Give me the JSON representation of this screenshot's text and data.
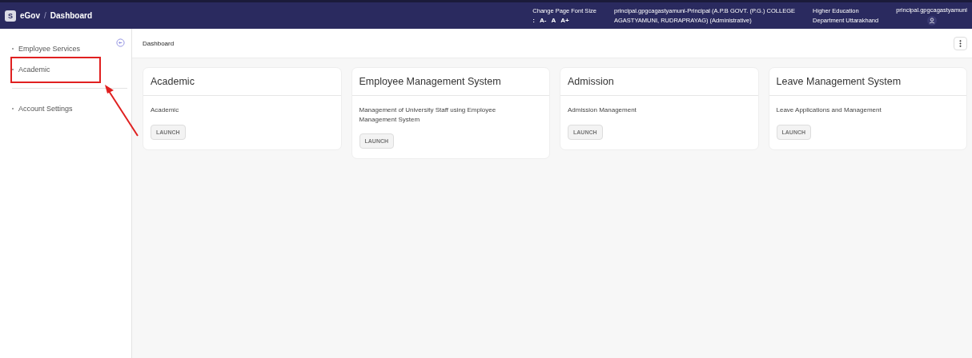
{
  "topbar": {
    "logo": "S",
    "app": "eGov",
    "separator": "/",
    "page": "Dashboard",
    "font_size": {
      "label": "Change Page Font Size",
      "colon": ":",
      "buttons": [
        "A-",
        "A",
        "A+"
      ]
    },
    "user_line1": "principal.gpgcagastyamuni-Principal (A.P.B GOVT. (P.G.) COLLEGE",
    "user_line2": "AGASTYAMUNI, RUDRAPRAYAG) (Administrative)",
    "department_line1": "Higher Education",
    "department_line2": "Department Uttarakhand",
    "username": "principal.gpgcagastyamuni"
  },
  "sidebar": {
    "groups": [
      {
        "items": [
          {
            "label": "Employee Services",
            "selected": false
          },
          {
            "label": "Academic",
            "selected": false,
            "highlighted": true
          }
        ]
      },
      {
        "items": [
          {
            "label": "Account Settings",
            "selected": false
          }
        ]
      }
    ]
  },
  "main": {
    "title": "Dashboard",
    "cards": [
      {
        "title": "Academic",
        "description": "Academic",
        "button": "LAUNCH"
      },
      {
        "title": "Employee Management System",
        "description": "Management of University Staff using Employee Management System",
        "button": "LAUNCH"
      },
      {
        "title": "Admission",
        "description": "Admission Management",
        "button": "LAUNCH"
      },
      {
        "title": "Leave Management System",
        "description": "Leave Applications and Management",
        "button": "LAUNCH"
      }
    ]
  }
}
